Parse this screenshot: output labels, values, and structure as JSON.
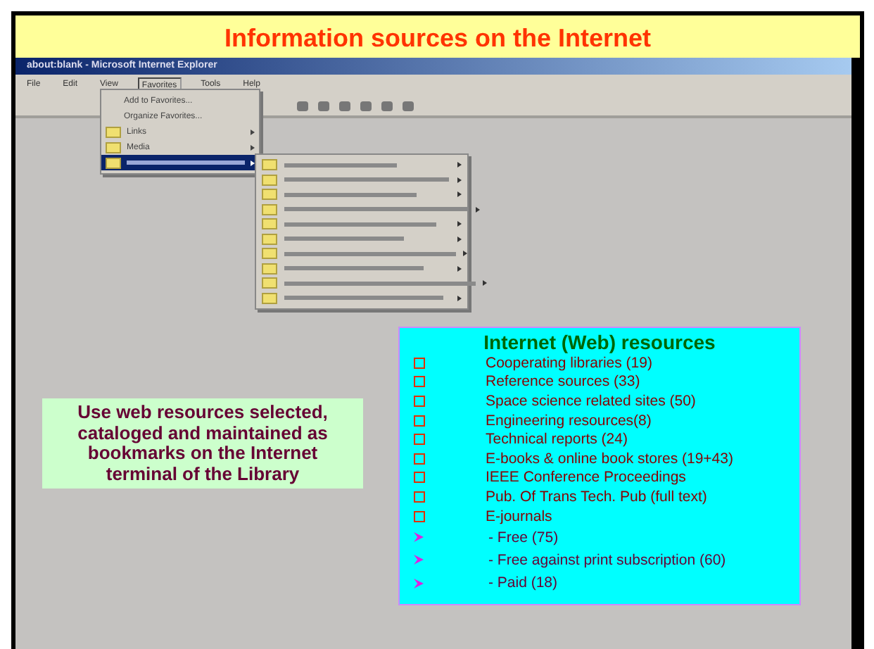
{
  "slide_title": "Information sources on the Internet",
  "browser": {
    "title": "about:blank - Microsoft Internet Explorer",
    "menu_bar": [
      {
        "label": "File",
        "selected": false
      },
      {
        "label": "Edit",
        "selected": false
      },
      {
        "label": "View",
        "selected": false
      },
      {
        "label": "Favorites",
        "selected": true
      },
      {
        "label": "Tools",
        "selected": false
      },
      {
        "label": "Help",
        "selected": false
      }
    ],
    "favorites_menu": [
      {
        "label": "Add to Favorites...",
        "kind": "command",
        "selected": false
      },
      {
        "label": "Organize Favorites...",
        "kind": "command",
        "selected": false
      },
      {
        "label": "Links",
        "kind": "folder",
        "selected": false
      },
      {
        "label": "Media",
        "kind": "folder",
        "selected": false
      },
      {
        "kind": "folder",
        "selected": true
      }
    ],
    "submenu": [
      {
        "kind": "folder"
      },
      {
        "kind": "folder"
      },
      {
        "kind": "folder"
      },
      {
        "kind": "folder"
      },
      {
        "kind": "folder"
      },
      {
        "kind": "folder"
      },
      {
        "kind": "folder"
      },
      {
        "kind": "folder"
      },
      {
        "kind": "folder"
      },
      {
        "kind": "folder"
      }
    ]
  },
  "note": "Use web resources selected, cataloged and maintained as  bookmarks on the Internet  terminal of the Library",
  "resources": {
    "heading": "Internet (Web) resources",
    "items": [
      {
        "text": "Cooperating libraries (19)",
        "kind": "square"
      },
      {
        "text": "Reference sources   (33)",
        "kind": "square"
      },
      {
        "text": "Space science related sites (50)",
        "kind": "square"
      },
      {
        "text": "Engineering resources(8)",
        "kind": "square"
      },
      {
        "text": "Technical reports (24)",
        "kind": "square"
      },
      {
        "text": "E-books & online book stores (19+43)",
        "kind": "square"
      },
      {
        "text": "IEEE Conference Proceedings",
        "kind": "square"
      },
      {
        "text": "Pub. Of Trans Tech. Pub (full text)",
        "kind": "square"
      },
      {
        "text": "E-journals",
        "kind": "square"
      },
      {
        "text": "- Free (75)",
        "kind": "arrow"
      },
      {
        "text": "- Free against print subscription   (60)",
        "kind": "arrow"
      },
      {
        "text": "- Paid (18)",
        "kind": "arrow"
      }
    ]
  }
}
